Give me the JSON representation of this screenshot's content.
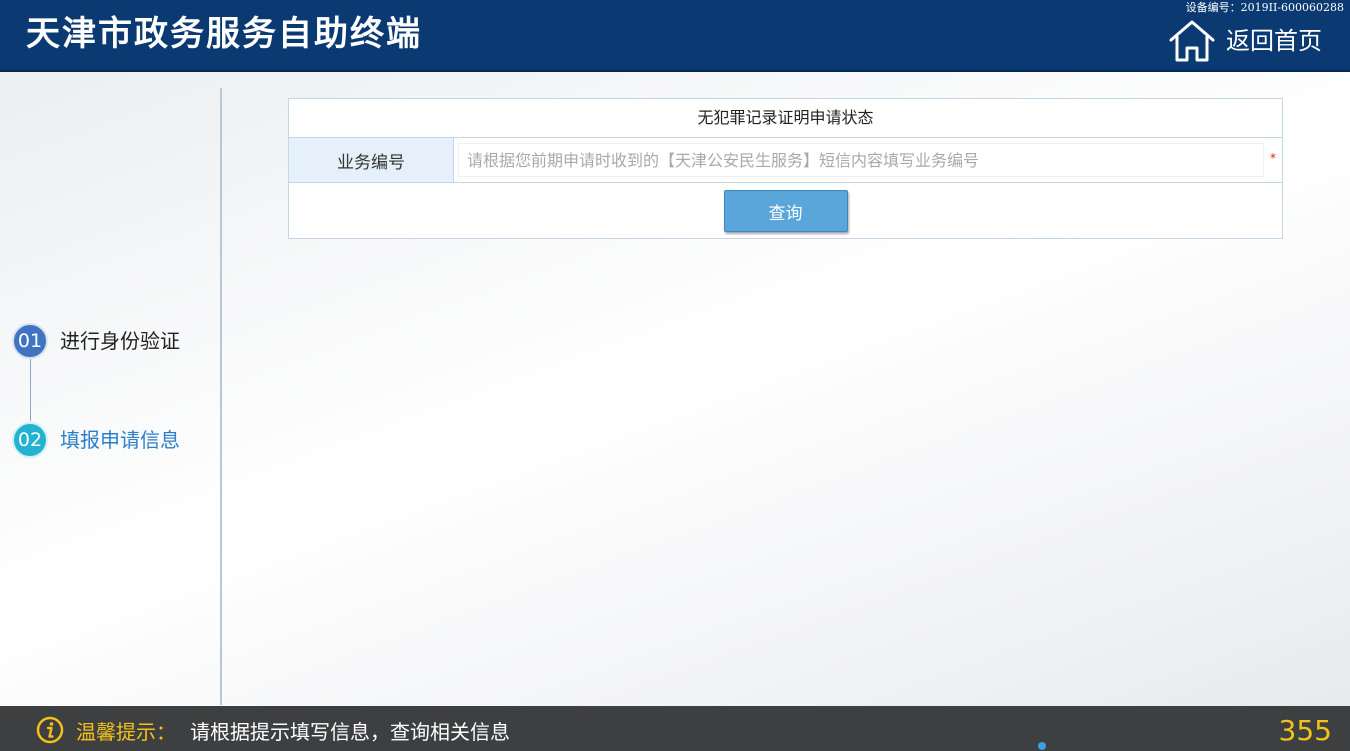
{
  "header": {
    "title": "天津市政务服务自助终端",
    "device_id": "设备编号：2019II-600060288",
    "home_label": "返回首页",
    "home_icon": "home-icon"
  },
  "sidebar": {
    "steps": [
      {
        "num": "01",
        "label": "进行身份验证",
        "active": false
      },
      {
        "num": "02",
        "label": "填报申请信息",
        "active": true
      }
    ]
  },
  "form": {
    "title": "无犯罪记录证明申请状态",
    "field_label": "业务编号",
    "field_value": "",
    "field_placeholder": "请根据您前期申请时收到的【天津公安民生服务】短信内容填写业务编号",
    "required_mark": "*",
    "query_label": "查询"
  },
  "footer": {
    "tip_icon": "info-icon",
    "tip_prefix": "温馨提示：",
    "tip_text": "请根据提示填写信息，查询相关信息",
    "countdown": "355"
  },
  "colors": {
    "header_bg": "#0b3a73",
    "accent_blue": "#5aa6db",
    "active_step": "#23b3d0",
    "tip_yellow": "#f2c21a",
    "footer_bg": "#3d3f41"
  }
}
